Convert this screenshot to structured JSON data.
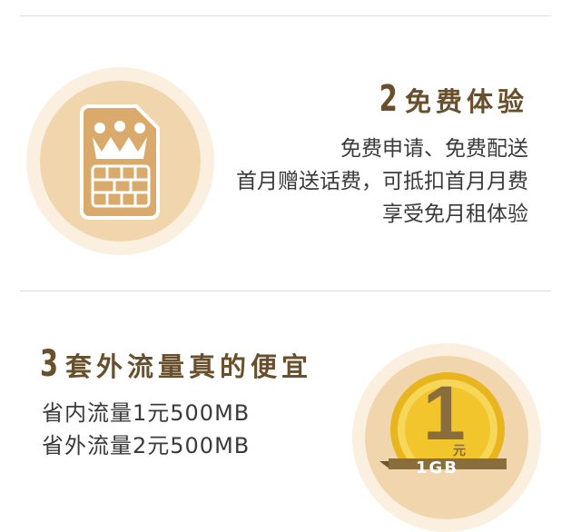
{
  "section2": {
    "number": "2",
    "title": "免费体验",
    "lines": [
      "免费申请、免费配送",
      "首月赠送话费，可抵扣首月月费",
      "享受免月租体验"
    ],
    "icon": "sim-card-crown-icon"
  },
  "section3": {
    "number": "3",
    "title": "套外流量真的便宜",
    "lines": [
      "省内流量1元500MB",
      "省外流量2元500MB"
    ],
    "coin": {
      "value": "1",
      "unit": "元",
      "ribbon_text": "1GB"
    },
    "icon": "coin-badge-icon"
  },
  "colors": {
    "heading": "#6a4f2c",
    "circle_light": "#fbf0e0",
    "circle_mid": "#f1d6ad",
    "sim_card": "#d9aa6b",
    "coin_gold": "#f2c52c",
    "ribbon": "#8a6d3c"
  }
}
